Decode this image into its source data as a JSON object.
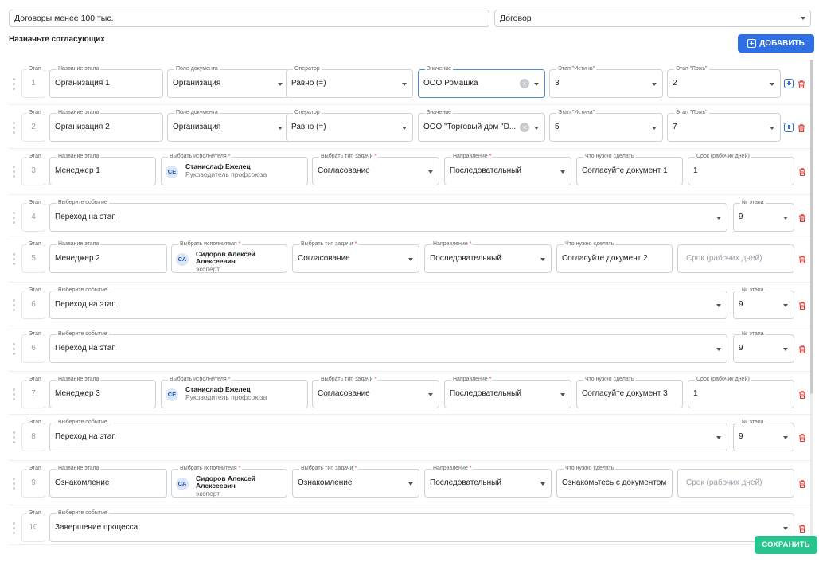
{
  "header": {
    "name_value": "Договоры менее 100 тыс.",
    "type_value": "Договор",
    "heading": "Назначьте согласующих",
    "add_button": "ДОБАВИТЬ"
  },
  "labels": {
    "step": "Этап",
    "stage_name": "Название этапа",
    "doc_field": "Поле документа",
    "operator": "Оператор",
    "value": "Значение",
    "stage_true": "Этап \"Истина\"",
    "stage_false": "Этап \"Ложь\"",
    "executor": "Выбрать исполнителя",
    "task_type": "Выбрать тип задачи",
    "direction": "Направление",
    "todo": "Что нужно сделать",
    "deadline": "Срок (рабочих дней)",
    "event": "Выберите событие",
    "stage_num": "№ этапа",
    "required_mark": "*"
  },
  "rows": [
    {
      "kind": "condition",
      "step": "1",
      "name": "Организация 1",
      "doc_field": "Организация",
      "operator": "Равно (=)",
      "value": "ООО Ромашка",
      "stage_true": "3",
      "stage_false": "2"
    },
    {
      "kind": "condition",
      "step": "2",
      "name": "Организация 2",
      "doc_field": "Организация",
      "operator": "Равно (=)",
      "value": "ООО \"Торговый дом \"D...",
      "stage_true": "5",
      "stage_false": "7"
    },
    {
      "kind": "approval",
      "step": "3",
      "name": "Менеджер 1",
      "avatar": "СЕ",
      "user_lines": [
        "Станислаф Ежелец"
      ],
      "role": "Руководитель профсоюза",
      "task_type": "Согласование",
      "direction": "Последовательный",
      "todo": "Согласуйте документ 1",
      "deadline": "1",
      "deadline_placeholder": ""
    },
    {
      "kind": "event",
      "step": "4",
      "event": "Переход на этап",
      "stage_num": "9"
    },
    {
      "kind": "approval",
      "step": "5",
      "name": "Менеджер 2",
      "avatar": "СА",
      "user_lines": [
        "Сидоров Алексей",
        "Алексеевич"
      ],
      "role": "эксперт",
      "task_type": "Согласование",
      "direction": "Последовательный",
      "todo": "Согласуйте документ 2",
      "deadline": "",
      "deadline_placeholder": "Срок (рабочих дней)"
    },
    {
      "kind": "event",
      "step": "6",
      "event": "Переход на этап",
      "stage_num": "9"
    },
    {
      "kind": "event",
      "step": "6",
      "event": "Переход на этап",
      "stage_num": "9"
    },
    {
      "kind": "approval",
      "step": "7",
      "name": "Менеджер 3",
      "avatar": "СЕ",
      "user_lines": [
        "Станислаф Ежелец"
      ],
      "role": "Руководитель профсоюза",
      "task_type": "Согласование",
      "direction": "Последовательный",
      "todo": "Согласуйте документ 3",
      "deadline": "1",
      "deadline_placeholder": ""
    },
    {
      "kind": "event",
      "step": "8",
      "event": "Переход на этап",
      "stage_num": "9"
    },
    {
      "kind": "approval",
      "step": "9",
      "name": "Ознакомление",
      "avatar": "СА",
      "user_lines": [
        "Сидоров Алексей",
        "Алексеевич"
      ],
      "role": "эксперт",
      "task_type": "Ознакомление",
      "direction": "Последовательный",
      "todo": "Ознакомьтесь с документом",
      "deadline": "",
      "deadline_placeholder": "Срок (рабочих дней)"
    },
    {
      "kind": "final",
      "step": "10",
      "event": "Завершение процесса"
    }
  ],
  "save_button": "СОХРАНИТЬ",
  "icons": {
    "drag": "drag-handle-icon",
    "add": "plus-square-icon",
    "delete": "trash-icon",
    "clear": "clear-icon",
    "dropdown": "chevron-down-icon"
  },
  "colors": {
    "primary": "#2f6fe4",
    "success": "#28c48e",
    "danger": "#e53935",
    "border": "#ced3da"
  }
}
